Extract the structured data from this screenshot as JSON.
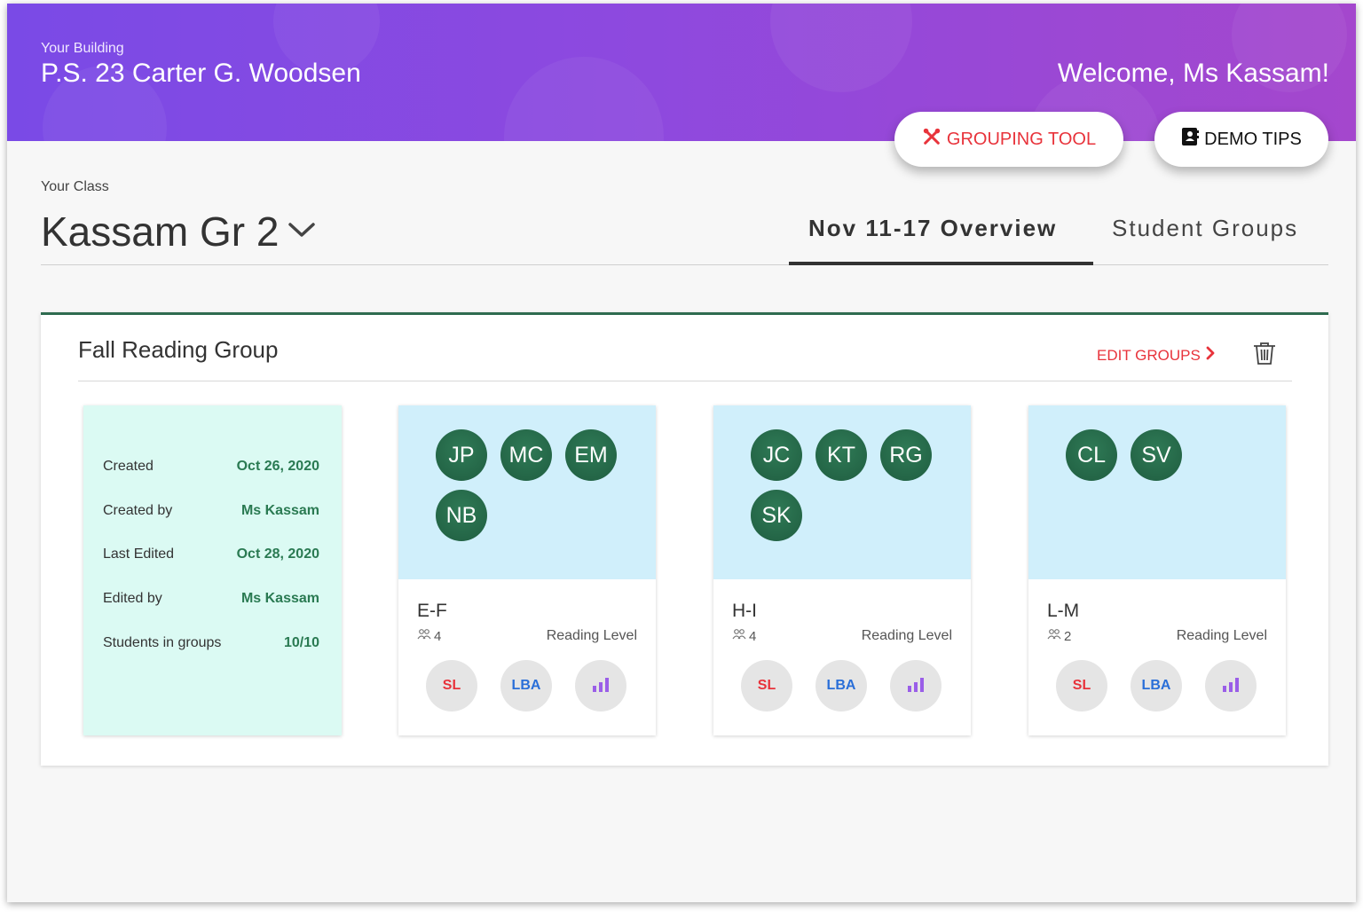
{
  "header": {
    "building_label": "Your Building",
    "building_name": "P.S. 23 Carter G. Woodsen",
    "welcome": "Welcome, Ms Kassam!",
    "grouping_tool_label": "GROUPING TOOL",
    "demo_tips_label": "DEMO TIPS",
    "colors": {
      "gradient_start": "#7a4ae6",
      "gradient_end": "#a447cd",
      "accent_red": "#e8333b"
    }
  },
  "class": {
    "label": "Your Class",
    "name": "Kassam Gr 2"
  },
  "tabs": [
    {
      "label": "Nov 11-17 Overview",
      "active": true
    },
    {
      "label": "Student Groups",
      "active": false
    }
  ],
  "panel": {
    "title": "Fall Reading Group",
    "edit_groups_label": "EDIT GROUPS",
    "info": [
      {
        "key": "Created",
        "value": "Oct 26, 2020"
      },
      {
        "key": "Created by",
        "value": "Ms Kassam"
      },
      {
        "key": "Last Edited",
        "value": "Oct 28, 2020"
      },
      {
        "key": "Edited by",
        "value": "Ms Kassam"
      },
      {
        "key": "Students in groups",
        "value": "10/10"
      }
    ],
    "groups": [
      {
        "level": "E-F",
        "count": "4",
        "metric": "Reading Level",
        "students": [
          "JP",
          "MC",
          "EM",
          "NB"
        ],
        "sl": "SL",
        "lba": "LBA"
      },
      {
        "level": "H-I",
        "count": "4",
        "metric": "Reading Level",
        "students": [
          "JC",
          "KT",
          "RG",
          "SK"
        ],
        "sl": "SL",
        "lba": "LBA"
      },
      {
        "level": "L-M",
        "count": "2",
        "metric": "Reading Level",
        "students": [
          "CL",
          "SV"
        ],
        "sl": "SL",
        "lba": "LBA"
      }
    ]
  },
  "icons": {
    "grouping_tool": "tools-icon",
    "demo_tips": "contact-book-icon",
    "class_dropdown": "chevron-down-icon",
    "edit_groups": "chevron-right-icon",
    "delete": "trash-icon",
    "count": "people-icon",
    "chart": "bar-chart-icon"
  }
}
